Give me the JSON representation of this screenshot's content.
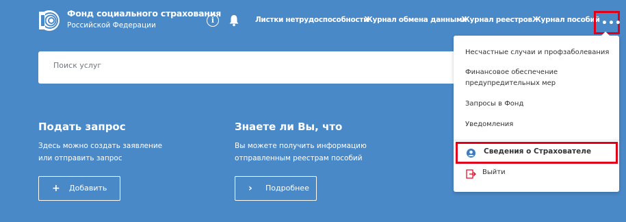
{
  "header": {
    "org_name": "Фонд социального страхования",
    "org_sub": "Российской Федерации",
    "info_icon": "info-icon",
    "bell_icon": "bell-icon",
    "nav": [
      "Листки нетрудоспособности",
      "Журнал обмена данными",
      "Журнал реестров",
      "Журнал пособий"
    ],
    "more_label": "•••"
  },
  "search": {
    "placeholder": "Поиск услуг",
    "value": ""
  },
  "cards": [
    {
      "title": "Подать запрос",
      "text": "Здесь можно создать заявление или отправить запрос",
      "button_icon": "+",
      "button_label": "Добавить"
    },
    {
      "title": "Знаете ли Вы, что",
      "text": "Вы можете получить информацию отправленным реестрам пособий",
      "button_icon": "›",
      "button_label": "Подробнее"
    }
  ],
  "dropdown": {
    "items": [
      "Несчастные случаи и профзаболевания",
      "Финансовое обеспечение",
      "предупредительных мер",
      "Запросы в Фонд",
      "Уведомления"
    ],
    "active_item": "Сведения о Страхователе",
    "exit_label": "Выйти"
  },
  "colors": {
    "background": "#4a89c8",
    "highlight": "#e1001a",
    "accent": "#3d7ec2"
  }
}
